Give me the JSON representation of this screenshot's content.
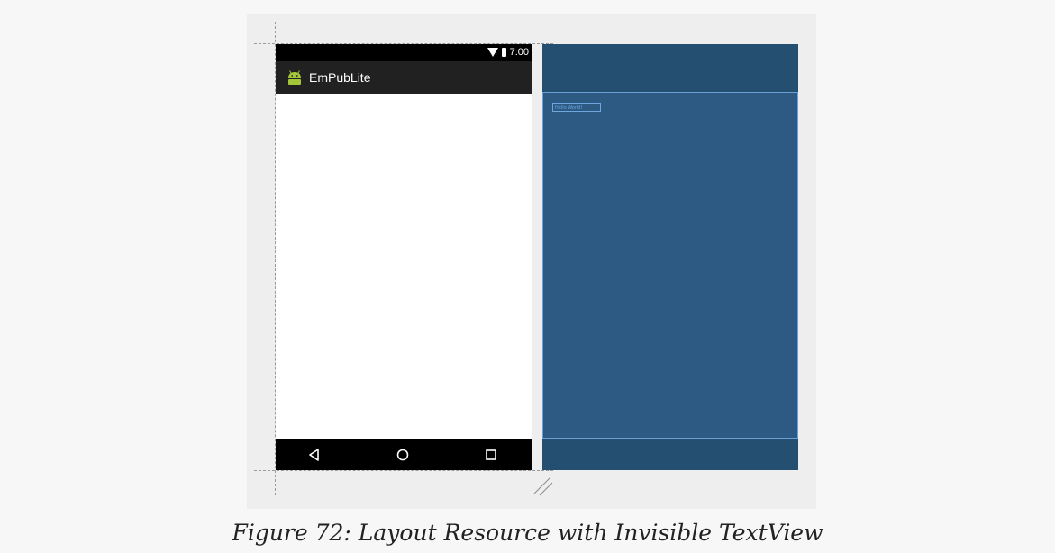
{
  "phone": {
    "status_time": "7:00",
    "app_title": "EmPubLite"
  },
  "blueprint": {
    "textview_text": "Hello World!"
  },
  "caption": "Figure 72: Layout Resource with Invisible TextView",
  "colors": {
    "canvas": "#eeeeee",
    "status_bar": "#000000",
    "app_bar": "#212121",
    "blueprint_bg": "#244f70",
    "blueprint_content": "#2c5a82",
    "blueprint_outline": "#6aa0d6",
    "android_green": "#a4c639"
  },
  "icons": {
    "status": [
      "wifi-icon",
      "battery-icon"
    ],
    "app": "android-icon",
    "nav": [
      "back-icon",
      "home-icon",
      "recents-icon"
    ],
    "resize": "resize-handle-icon"
  }
}
